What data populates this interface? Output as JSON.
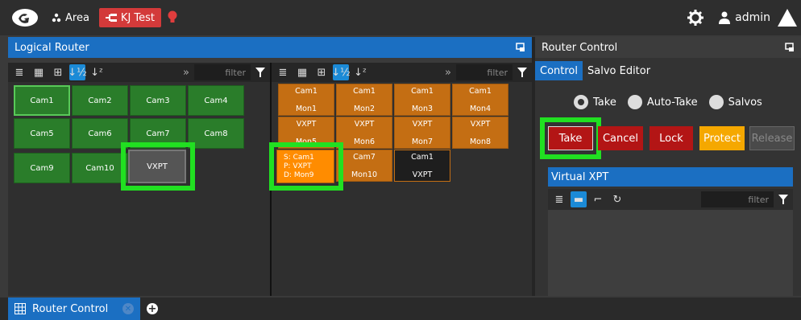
{
  "topbar": {
    "area_label": "Area",
    "tab_label": "KJ Test",
    "user_label": "admin"
  },
  "logical_router": {
    "title": "Logical Router",
    "filter_placeholder": "filter",
    "sources": [
      {
        "label": "Cam1",
        "state": "selected"
      },
      {
        "label": "Cam2",
        "state": "normal"
      },
      {
        "label": "Cam3",
        "state": "normal"
      },
      {
        "label": "Cam4",
        "state": "normal"
      },
      {
        "label": "Cam5",
        "state": "normal"
      },
      {
        "label": "Cam6",
        "state": "normal"
      },
      {
        "label": "Cam7",
        "state": "normal"
      },
      {
        "label": "Cam8",
        "state": "normal"
      },
      {
        "label": "Cam9",
        "state": "normal"
      },
      {
        "label": "Cam10",
        "state": "normal"
      },
      {
        "label": "VXPT",
        "state": "highlighted"
      }
    ],
    "destinations": [
      {
        "top": "Cam1",
        "bottom": "Mon1"
      },
      {
        "top": "Cam1",
        "bottom": "Mon2"
      },
      {
        "top": "Cam1",
        "bottom": "Mon3"
      },
      {
        "top": "Cam1",
        "bottom": "Mon4"
      },
      {
        "top": "VXPT",
        "bottom": "Mon5"
      },
      {
        "top": "VXPT",
        "bottom": "Mon6"
      },
      {
        "top": "VXPT",
        "bottom": "Mon7"
      },
      {
        "top": "VXPT",
        "bottom": "Mon8"
      },
      {
        "lines": [
          "S: Cam1",
          "P: VXPT",
          "D: Mon9"
        ]
      },
      {
        "top": "Cam7",
        "bottom": "Mon10"
      },
      {
        "top": "Cam1",
        "bottom": "VXPT"
      }
    ]
  },
  "router_control": {
    "title": "Router Control",
    "tabs": [
      "Control",
      "Salvo Editor"
    ],
    "modes": [
      "Take",
      "Auto-Take",
      "Salvos"
    ],
    "buttons": {
      "take": "Take",
      "cancel": "Cancel",
      "lock": "Lock",
      "protect": "Protect",
      "release": "Release"
    },
    "virtual_xpt": {
      "title": "Virtual XPT",
      "filter_placeholder": "filter"
    }
  },
  "bottombar": {
    "tab_label": "Router Control"
  },
  "colors": {
    "accent": "#1b6fc2",
    "source_green": "#2a7d2a",
    "dest_orange": "#c46e13",
    "alert_red": "#b31515",
    "protect_amber": "#f5a800",
    "highlight_green": "#21e021"
  }
}
